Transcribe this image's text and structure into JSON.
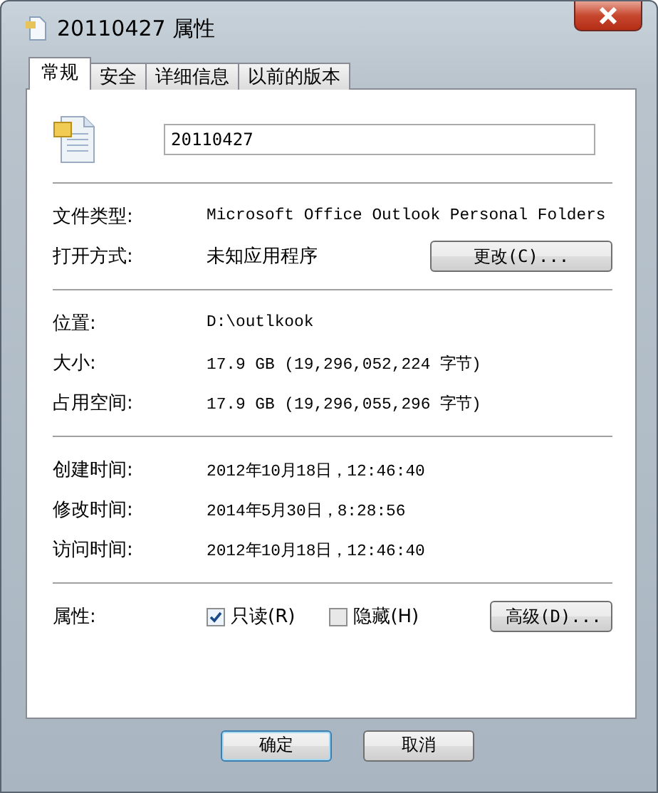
{
  "window": {
    "title": "20110427 属性"
  },
  "tabs": [
    {
      "label": "常规",
      "selected": true
    },
    {
      "label": "安全",
      "selected": false
    },
    {
      "label": "详细信息",
      "selected": false
    },
    {
      "label": "以前的版本",
      "selected": false
    }
  ],
  "file_name": {
    "value": "20110427"
  },
  "sections": [
    [
      {
        "label": "文件类型:",
        "value": "Microsoft Office Outlook Personal Folders"
      },
      {
        "label": "打开方式:",
        "value": "未知应用程序",
        "button": "更改(C)..."
      }
    ],
    [
      {
        "label": "位置:",
        "value": "D:\\outlkook"
      },
      {
        "label": "大小:",
        "value": "17.9 GB (19,296,052,224 字节)"
      },
      {
        "label": "占用空间:",
        "value": "17.9 GB (19,296,055,296 字节)"
      }
    ],
    [
      {
        "label": "创建时间:",
        "value": "2012年10月18日，12:46:40"
      },
      {
        "label": "修改时间:",
        "value": "2014年5月30日，8:28:56"
      },
      {
        "label": "访问时间:",
        "value": "2012年10月18日，12:46:40"
      }
    ],
    [
      {
        "label": "属性:",
        "checkboxes": [
          {
            "label": "只读(R)",
            "checked": true
          },
          {
            "label": "隐藏(H)",
            "checked": false
          }
        ],
        "button": "高级(D)..."
      }
    ]
  ],
  "buttons": [
    {
      "label": "确定",
      "default": true
    },
    {
      "label": "取消",
      "default": false
    }
  ]
}
